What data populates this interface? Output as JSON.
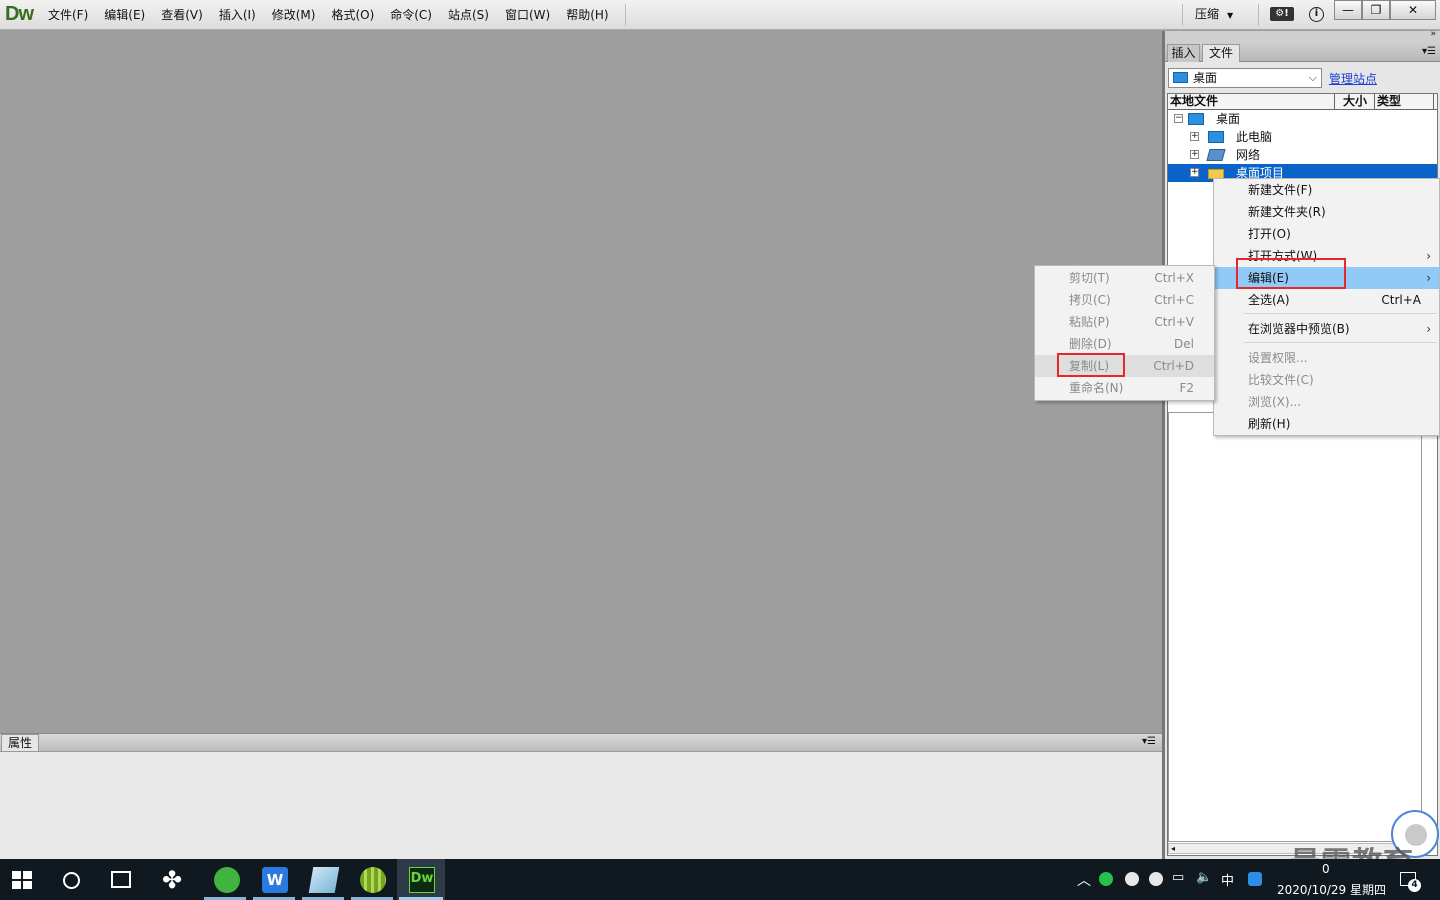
{
  "app": {
    "logo": "Dw",
    "menus": [
      "文件(F)",
      "编辑(E)",
      "查看(V)",
      "插入(I)",
      "修改(M)",
      "格式(O)",
      "命令(C)",
      "站点(S)",
      "窗口(W)",
      "帮助(H)"
    ],
    "compress_label": "压缩"
  },
  "properties_panel": {
    "tab_label": "属性"
  },
  "right_panel": {
    "tabs": [
      "插入",
      "文件"
    ],
    "site_select_value": "桌面",
    "manage_sites_link": "管理站点",
    "columns": {
      "name": "本地文件",
      "size": "大小",
      "type": "类型"
    },
    "tree": [
      {
        "label": "桌面",
        "level": 0,
        "icon": "pc-icon",
        "expander": "⊟",
        "selected": false
      },
      {
        "label": "此电脑",
        "level": 1,
        "icon": "pc-icon",
        "expander": "+",
        "selected": false
      },
      {
        "label": "网络",
        "level": 1,
        "icon": "network-icon",
        "expander": "+",
        "selected": false
      },
      {
        "label": "桌面项目",
        "level": 1,
        "icon": "folder-icon",
        "expander": "+",
        "selected": true
      }
    ]
  },
  "context_menu": {
    "items": [
      {
        "label": "新建文件(F)",
        "shortcut": "",
        "submenu": false,
        "disabled": false
      },
      {
        "label": "新建文件夹(R)",
        "shortcut": "",
        "submenu": false,
        "disabled": false
      },
      {
        "label": "打开(O)",
        "shortcut": "",
        "submenu": false,
        "disabled": false
      },
      {
        "label": "打开方式(W)",
        "shortcut": "",
        "submenu": true,
        "disabled": false
      },
      {
        "label": "编辑(E)",
        "shortcut": "",
        "submenu": true,
        "disabled": false,
        "highlighted": true
      },
      {
        "label": "全选(A)",
        "shortcut": "Ctrl+A",
        "submenu": false,
        "disabled": false
      },
      {
        "label": "在浏览器中预览(B)",
        "shortcut": "",
        "submenu": true,
        "disabled": false
      },
      {
        "label": "设置权限...",
        "shortcut": "",
        "submenu": false,
        "disabled": true
      },
      {
        "label": "比较文件(C)",
        "shortcut": "",
        "submenu": false,
        "disabled": true
      },
      {
        "label": "浏览(X)...",
        "shortcut": "",
        "submenu": false,
        "disabled": true
      },
      {
        "label": "刷新(H)",
        "shortcut": "",
        "submenu": false,
        "disabled": false
      }
    ]
  },
  "edit_submenu": {
    "items": [
      {
        "label": "剪切(T)",
        "shortcut": "Ctrl+X",
        "disabled": true
      },
      {
        "label": "拷贝(C)",
        "shortcut": "Ctrl+C",
        "disabled": true
      },
      {
        "label": "粘贴(P)",
        "shortcut": "Ctrl+V",
        "disabled": true
      },
      {
        "label": "删除(D)",
        "shortcut": "Del",
        "disabled": true
      },
      {
        "label": "复制(L)",
        "shortcut": "Ctrl+D",
        "disabled": true,
        "highlighted": true
      },
      {
        "label": "重命名(N)",
        "shortcut": "F2",
        "disabled": true
      }
    ]
  },
  "watermark": {
    "text": "最需教育"
  },
  "taskbar": {
    "apps": [
      "start-icon",
      "search-icon",
      "task-view-icon",
      "fan-app-icon",
      "browser-icon",
      "wps-icon",
      "notes-icon",
      "melon-icon",
      "dreamweaver-icon"
    ],
    "wps_glyph": "W",
    "dw_glyph": "Dw",
    "ime": "中",
    "clock_time": "0",
    "clock_date": "2020/10/29 星期四",
    "notification_count": "4"
  },
  "colors": {
    "selection": "#0a63c9",
    "menu_highlight": "#91c9f7",
    "annotation_red": "#e5282a",
    "link": "#1a3fd6"
  }
}
